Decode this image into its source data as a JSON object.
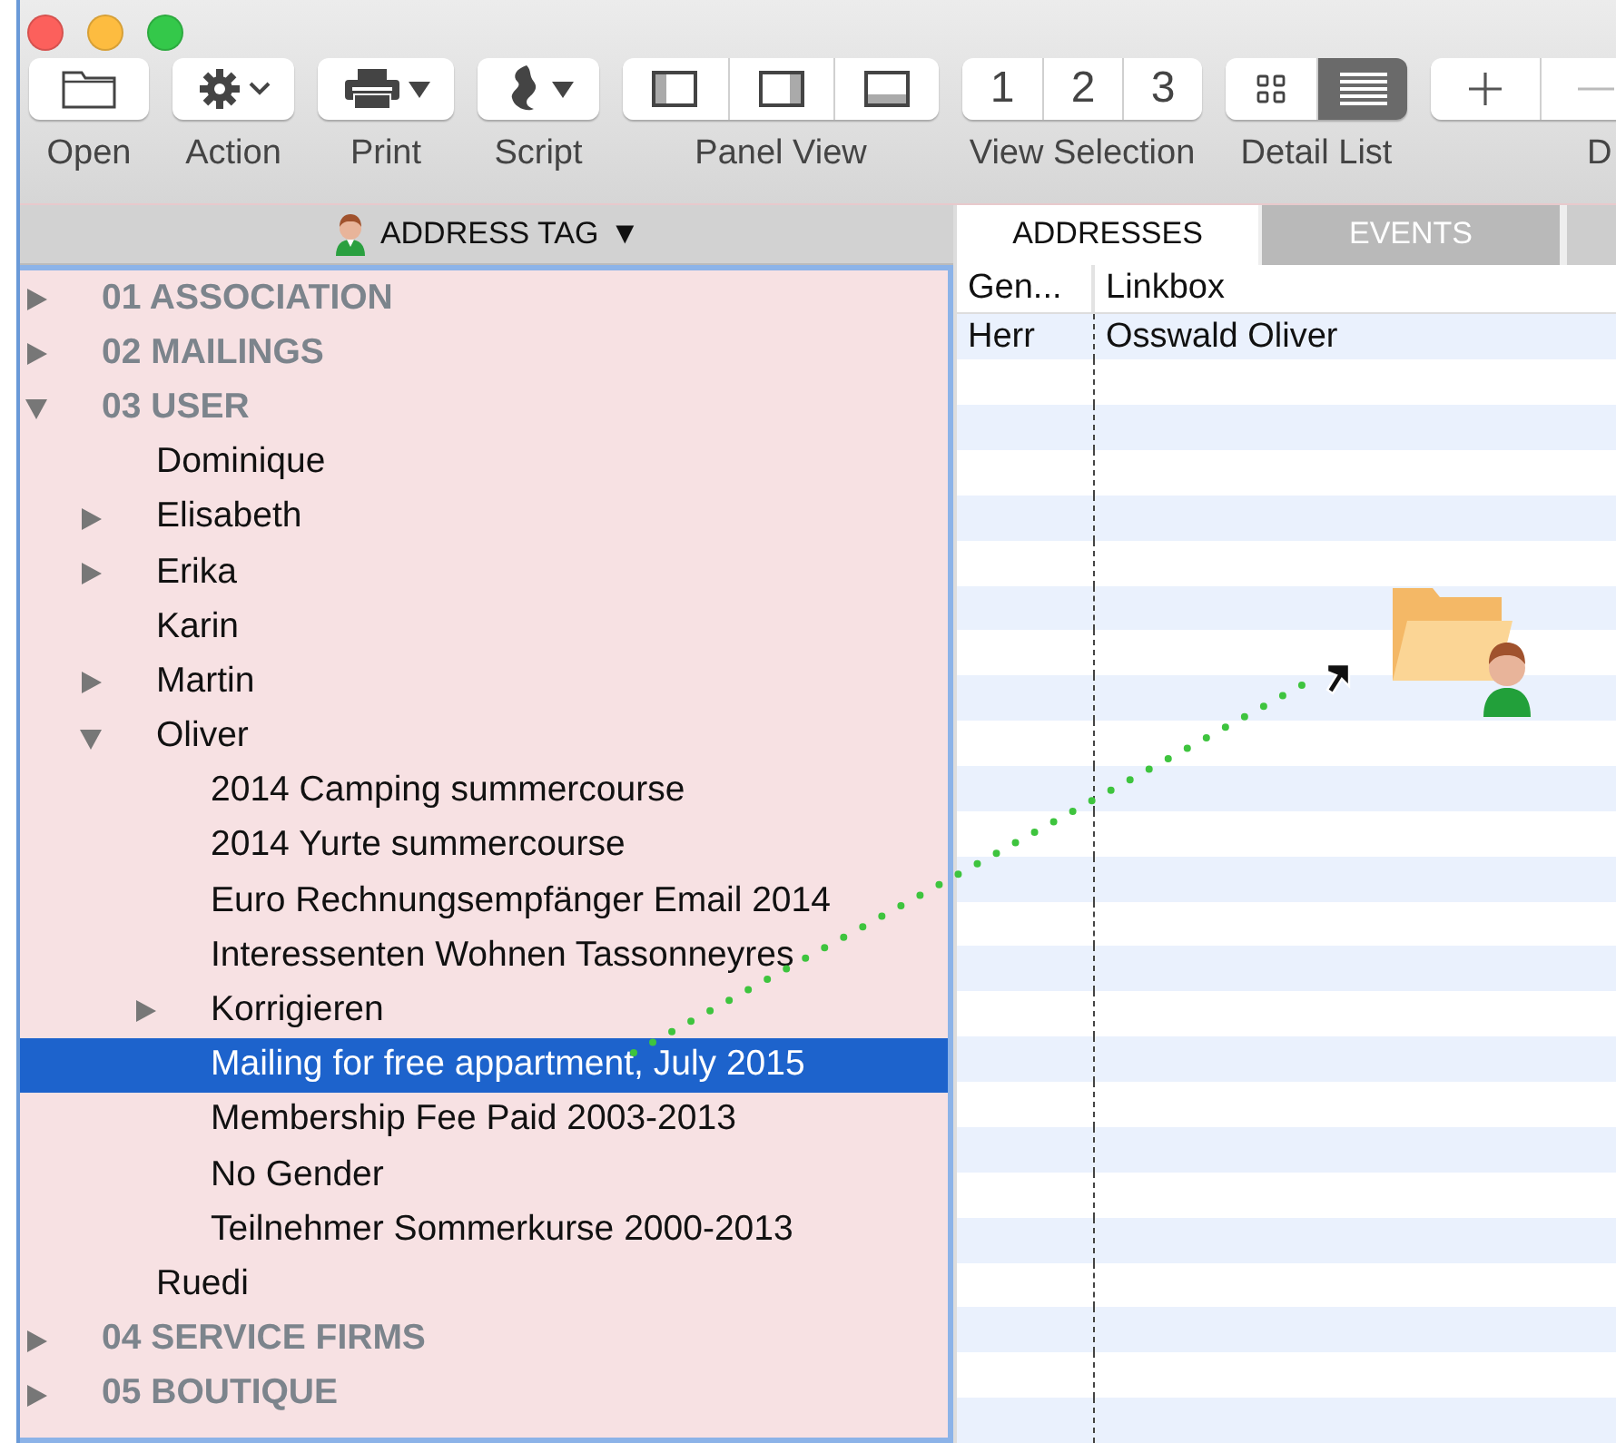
{
  "toolbar": [
    {
      "kind": "open",
      "label": "Open"
    },
    {
      "kind": "action",
      "label": "Action"
    },
    {
      "kind": "print",
      "label": "Print"
    },
    {
      "kind": "script",
      "label": "Script"
    },
    {
      "kind": "panel-view",
      "label": "Panel View",
      "segments": [
        {
          "selected": false
        },
        {
          "selected": false
        },
        {
          "selected": false
        }
      ]
    },
    {
      "kind": "view-selection",
      "label": "View Selection",
      "segments": [
        {
          "text": "1",
          "selected": false
        },
        {
          "text": "2",
          "selected": false
        },
        {
          "text": "3",
          "selected": false
        }
      ]
    },
    {
      "kind": "detail-list",
      "label": "Detail List",
      "segments": [
        {
          "selected": false
        },
        {
          "selected": true
        }
      ]
    },
    {
      "kind": "add-remove",
      "label": "D"
    }
  ],
  "tree_header": {
    "title": "ADDRESS TAG",
    "caret": "▼"
  },
  "tree": [
    {
      "label": "01 ASSOCIATION",
      "expandable": true,
      "expanded": false,
      "selected": false
    },
    {
      "label": "02 MAILINGS",
      "expandable": true,
      "expanded": false,
      "selected": false
    },
    {
      "label": "03 USER",
      "expandable": true,
      "expanded": true,
      "selected": false,
      "children": [
        {
          "label": "Dominique",
          "expandable": false,
          "selected": false
        },
        {
          "label": "Elisabeth",
          "expandable": true,
          "expanded": false,
          "selected": false
        },
        {
          "label": "Erika",
          "expandable": true,
          "expanded": false,
          "selected": false
        },
        {
          "label": "Karin",
          "expandable": false,
          "selected": false
        },
        {
          "label": "Martin",
          "expandable": true,
          "expanded": false,
          "selected": false
        },
        {
          "label": "Oliver",
          "expandable": true,
          "expanded": true,
          "selected": false,
          "children": [
            {
              "label": "2014 Camping summercourse",
              "expandable": false,
              "selected": false
            },
            {
              "label": "2014 Yurte summercourse",
              "expandable": false,
              "selected": false
            },
            {
              "label": "Euro Rechnungsempfänger Email 2014",
              "expandable": false,
              "selected": false
            },
            {
              "label": "Interessenten Wohnen Tassonneyres",
              "expandable": false,
              "selected": false
            },
            {
              "label": "Korrigieren",
              "expandable": true,
              "expanded": false,
              "selected": false
            },
            {
              "label": "Mailing for free appartment, July 2015",
              "expandable": false,
              "selected": true
            },
            {
              "label": "Membership Fee Paid 2003-2013",
              "expandable": false,
              "selected": false
            },
            {
              "label": "No Gender",
              "expandable": false,
              "selected": false
            },
            {
              "label": "Teilnehmer Sommerkurse 2000-2013",
              "expandable": false,
              "selected": false
            }
          ]
        },
        {
          "label": "Ruedi",
          "expandable": false,
          "selected": false
        }
      ]
    },
    {
      "label": "04 SERVICE FIRMS",
      "expandable": true,
      "expanded": false,
      "selected": false
    },
    {
      "label": "05 BOUTIQUE",
      "expandable": true,
      "expanded": false,
      "selected": false
    }
  ],
  "tabs": [
    {
      "label": "ADDRESSES",
      "selected": true
    },
    {
      "label": "EVENTS",
      "selected": false
    }
  ],
  "table": {
    "columns": [
      "Gen...",
      "Linkbox"
    ],
    "rows": [
      [
        "Herr",
        "Osswald Oliver"
      ]
    ]
  }
}
